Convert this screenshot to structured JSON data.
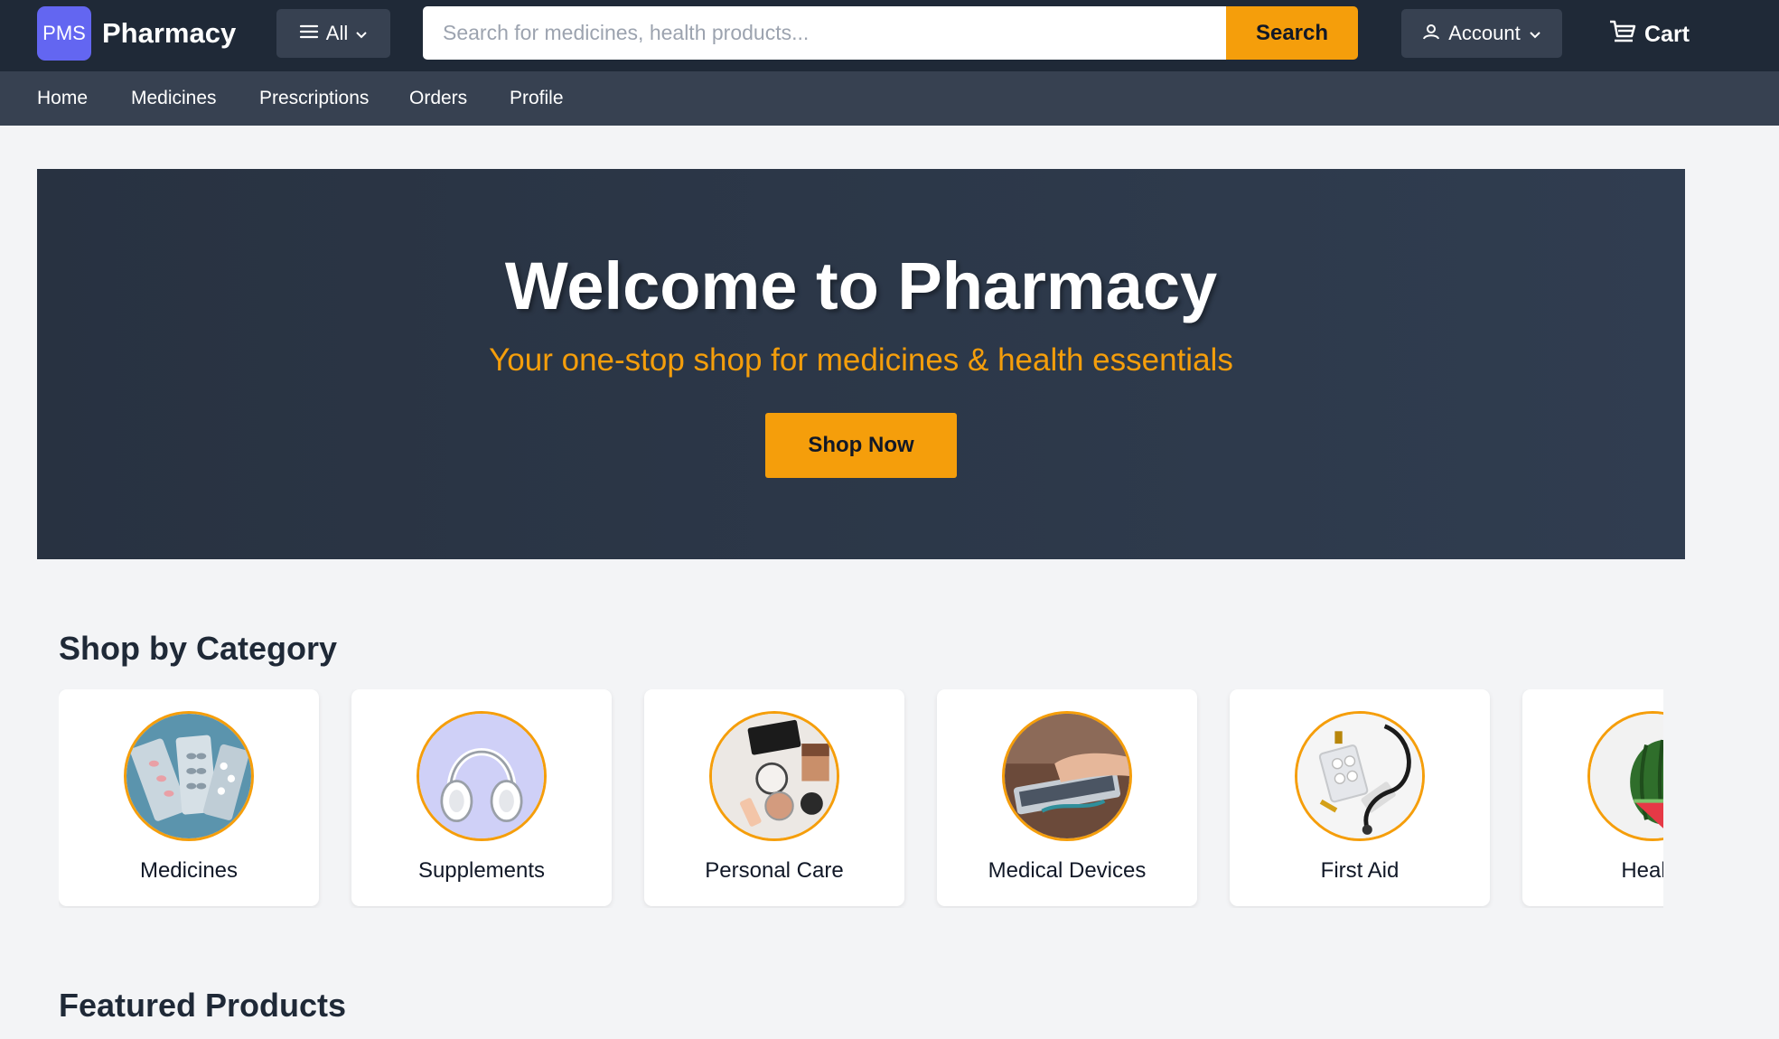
{
  "header": {
    "logo_text": "PMS",
    "brand": "Pharmacy",
    "all_label": "All",
    "search_placeholder": "Search for medicines, health products...",
    "search_button": "Search",
    "account_label": "Account",
    "cart_label": "Cart"
  },
  "nav": {
    "items": [
      {
        "label": "Home"
      },
      {
        "label": "Medicines"
      },
      {
        "label": "Prescriptions"
      },
      {
        "label": "Orders"
      },
      {
        "label": "Profile"
      }
    ]
  },
  "hero": {
    "title": "Welcome to Pharmacy",
    "subtitle": "Your one-stop shop for medicines & health essentials",
    "cta": "Shop Now"
  },
  "categories": {
    "title": "Shop by Category",
    "items": [
      {
        "label": "Medicines"
      },
      {
        "label": "Supplements"
      },
      {
        "label": "Personal Care"
      },
      {
        "label": "Medical Devices"
      },
      {
        "label": "First Aid"
      },
      {
        "label": "Health"
      }
    ]
  },
  "featured": {
    "title": "Featured Products"
  },
  "colors": {
    "topbar": "#1f2937",
    "navbar": "#374151",
    "accent": "#f59e0b",
    "logo": "#6366f1"
  }
}
